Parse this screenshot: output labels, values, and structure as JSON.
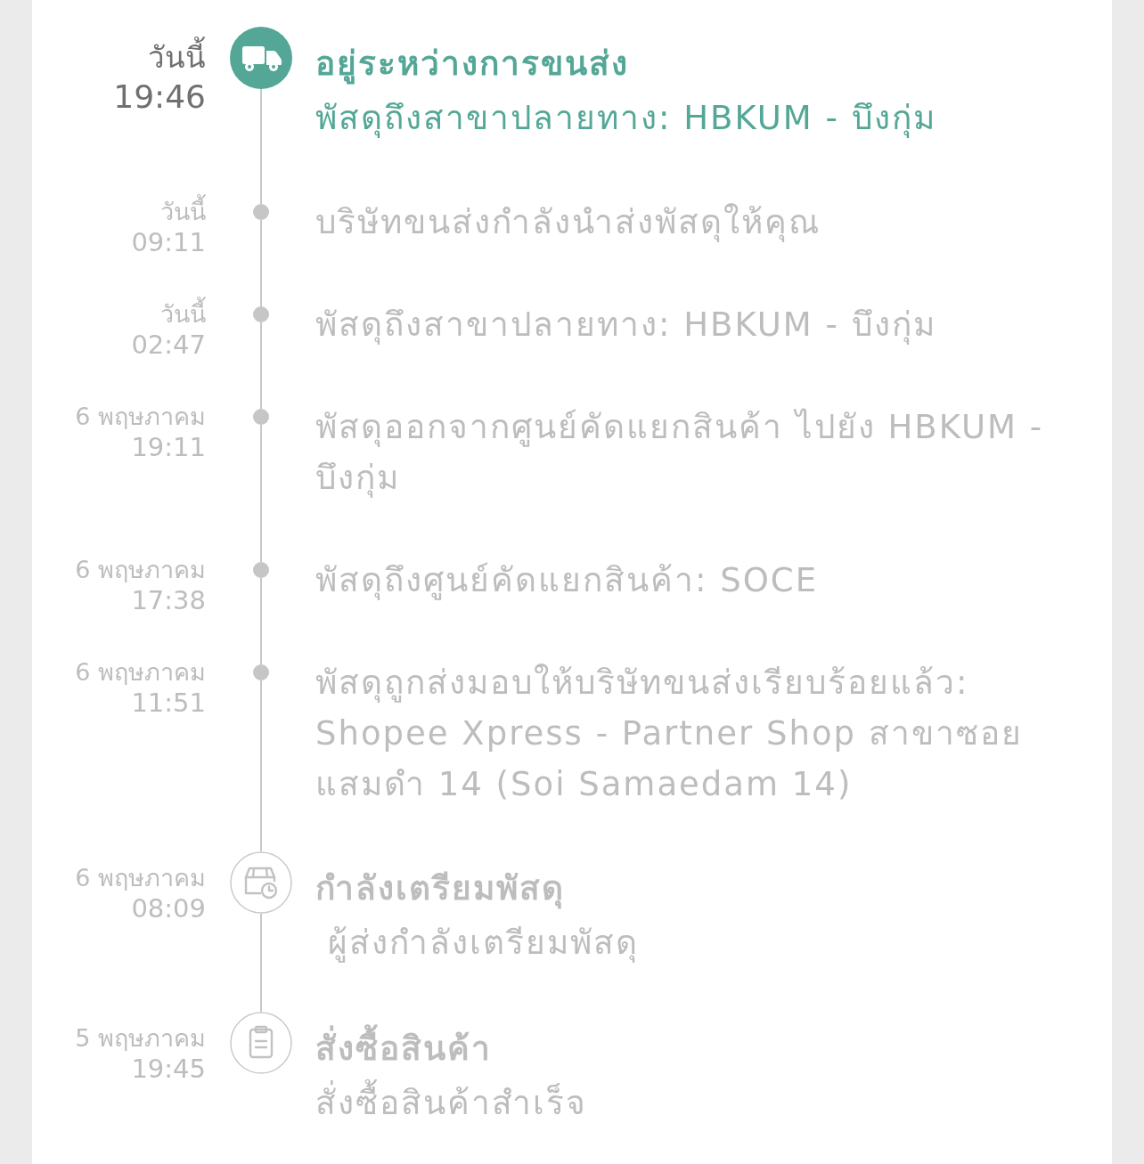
{
  "events": [
    {
      "kind": "transit",
      "current": true,
      "date": "วันนี้",
      "time": "19:46",
      "title": "อยู่ระหว่างการขนส่ง",
      "detail": "พัสดุถึงสาขาปลายทาง: HBKUM - บึงกุ่ม"
    },
    {
      "kind": "update",
      "current": false,
      "date": "วันนี้",
      "time": "09:11",
      "detail": "บริษัทขนส่งกำลังนำส่งพัสดุให้คุณ"
    },
    {
      "kind": "update",
      "current": false,
      "date": "วันนี้",
      "time": "02:47",
      "detail": "พัสดุถึงสาขาปลายทาง: HBKUM - บึงกุ่ม"
    },
    {
      "kind": "update",
      "current": false,
      "date": "6 พฤษภาคม",
      "time": "19:11",
      "detail": "พัสดุออกจากศูนย์คัดแยกสินค้า ไปยัง HBKUM - บึงกุ่ม"
    },
    {
      "kind": "update",
      "current": false,
      "date": "6 พฤษภาคม",
      "time": "17:38",
      "detail": "พัสดุถึงศูนย์คัดแยกสินค้า: SOCE"
    },
    {
      "kind": "update",
      "current": false,
      "date": "6 พฤษภาคม",
      "time": "11:51",
      "detail": "พัสดุถูกส่งมอบให้บริษัทขนส่งเรียบร้อยแล้ว: Shopee Xpress - Partner Shop สาขาซอยแสมดำ 14 (Soi Samaedam 14)"
    },
    {
      "kind": "preparing",
      "current": false,
      "date": "6 พฤษภาคม",
      "time": "08:09",
      "title": "กำลังเตรียมพัสดุ",
      "detail": " ผู้ส่งกำลังเตรียมพัสดุ"
    },
    {
      "kind": "ordered",
      "current": false,
      "date": "5 พฤษภาคม",
      "time": "19:45",
      "title": "สั่งซื้อสินค้า",
      "detail": "สั่งซื้อสินค้าสำเร็จ"
    }
  ]
}
